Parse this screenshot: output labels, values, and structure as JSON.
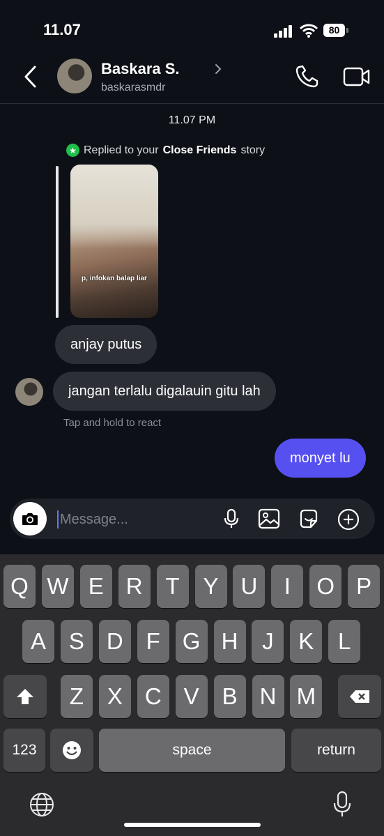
{
  "status": {
    "time": "11.07",
    "battery": "80"
  },
  "header": {
    "name": "Baskara S.",
    "username": "baskarasmdr"
  },
  "thread": {
    "timestamp": "11.07 PM",
    "reply_prefix": "Replied to your",
    "reply_bold": "Close Friends",
    "reply_suffix": "story",
    "story_caption": "p, infokan balap liar",
    "messages": [
      {
        "text": "anjay putus",
        "from": "them"
      },
      {
        "text": "jangan terlalu digalauin gitu lah",
        "from": "them"
      },
      {
        "text": "monyet lu",
        "from": "me"
      }
    ],
    "hint": "Tap and hold to react"
  },
  "composer": {
    "placeholder": "Message..."
  },
  "keyboard": {
    "row1": [
      "Q",
      "W",
      "E",
      "R",
      "T",
      "Y",
      "U",
      "I",
      "O",
      "P"
    ],
    "row2": [
      "A",
      "S",
      "D",
      "F",
      "G",
      "H",
      "J",
      "K",
      "L"
    ],
    "row3": [
      "Z",
      "X",
      "C",
      "V",
      "B",
      "N",
      "M"
    ],
    "numbers": "123",
    "space": "space",
    "return": "return"
  },
  "colors": {
    "outgoing_bubble": "#5750f0",
    "incoming_bubble": "#2c2f36",
    "close_friends": "#1ec04a"
  }
}
